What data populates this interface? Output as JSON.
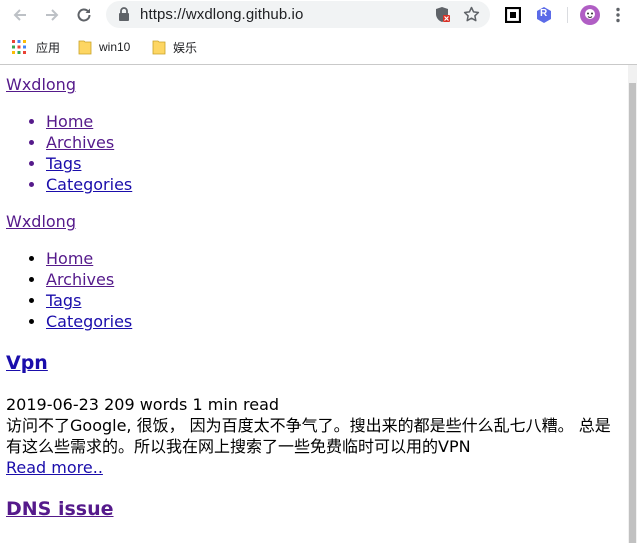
{
  "browser": {
    "url": "https://wxdlong.github.io",
    "bookmarks": [
      {
        "label": "应用",
        "icon": "apps-grid-icon"
      },
      {
        "label": "win10",
        "icon": "folder-icon"
      },
      {
        "label": "娱乐",
        "icon": "folder-icon"
      }
    ],
    "extension_badge": "R"
  },
  "page": {
    "site_name": "Wxdlong",
    "menu_primary": [
      "Home",
      "Archives",
      "Tags",
      "Categories"
    ],
    "site_name_2": "Wxdlong",
    "menu_secondary": [
      "Home",
      "Archives",
      "Tags",
      "Categories"
    ],
    "posts": [
      {
        "title": "Vpn",
        "date": "2019-06-23",
        "words": "209 words",
        "read_time": "1 min read",
        "excerpt_line1": "访问不了Google, 很饭， 因为百度太不争气了。搜出来的都是些什么乱七八糟。 总是",
        "excerpt_line2": "有这么些需求的。所以我在网上搜索了一些免费临时可以用的VPN",
        "read_more": "Read more.."
      },
      {
        "title": "DNS issue"
      }
    ]
  }
}
